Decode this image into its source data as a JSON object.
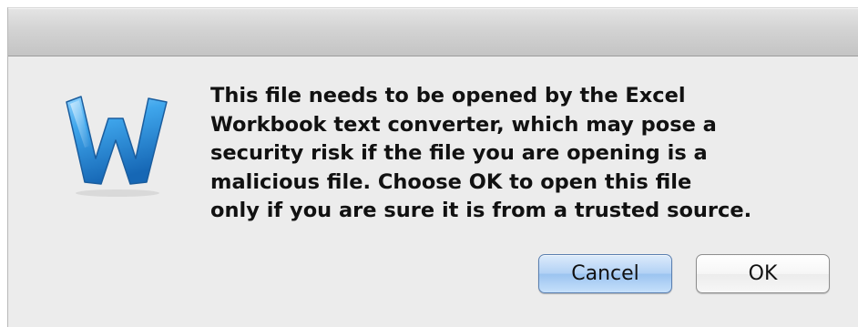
{
  "dialog": {
    "app_icon": "word-app-icon",
    "message": "This file needs to be opened by the Excel\nWorkbook text converter, which may pose a\nsecurity risk if the file you are opening is a\nmalicious file.  Choose OK to open this file\nonly if you are sure it is from a trusted source.",
    "buttons": {
      "cancel_label": "Cancel",
      "ok_label": "OK"
    },
    "colors": {
      "icon_blue": "#2f8fd8",
      "default_button": "#b4d2f5",
      "background": "#ececec"
    }
  }
}
